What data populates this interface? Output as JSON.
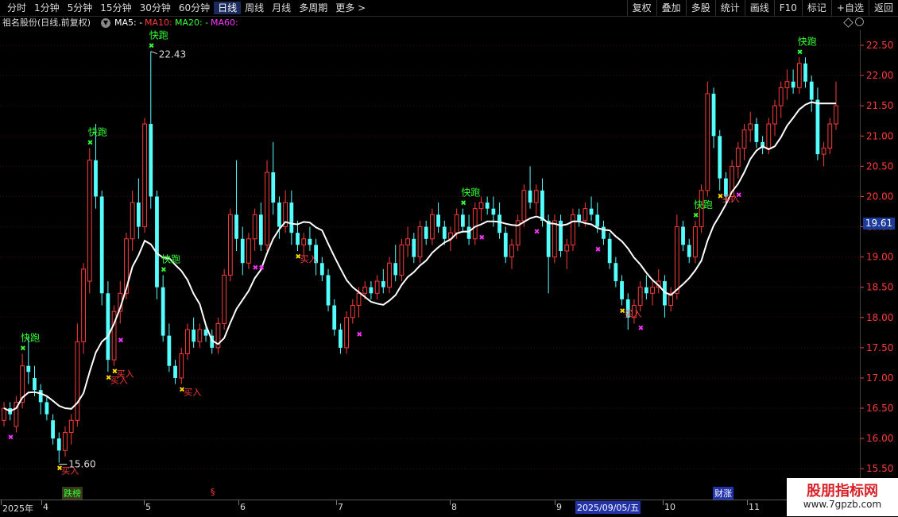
{
  "toolbar": {
    "tabs": [
      "分时",
      "1分钟",
      "5分钟",
      "15分钟",
      "30分钟",
      "60分钟",
      "日线",
      "周线",
      "月线",
      "多周期",
      "更多 >"
    ],
    "active_tab": "日线",
    "right_buttons": [
      "复权",
      "叠加",
      "多股",
      "统计",
      "画线",
      "F10",
      "标记",
      "+自选",
      "返回"
    ]
  },
  "info": {
    "stock": "祖名股份(日线,前复权)",
    "ma5": "MA5: -",
    "ma10": "MA10: -",
    "ma20": "MA20: -",
    "ma60": "MA60:"
  },
  "colors": {
    "up": "#ff3b3b",
    "down": "#54ffff",
    "ma": "#ffffff",
    "signal_sell": "#33ff33",
    "signal_buy": "#ff3b3b",
    "buy_marker": "#ffd700",
    "magenta": "#ff33ff",
    "axis": "#ff3b3b"
  },
  "price_axis": {
    "ticks": [
      "22.50",
      "22.00",
      "21.50",
      "21.00",
      "20.50",
      "20.00",
      "19.50",
      "19.00",
      "18.50",
      "18.00",
      "17.50",
      "17.00",
      "16.50",
      "16.00",
      "15.50"
    ],
    "current": "19.61"
  },
  "annotations": {
    "high": "22.43",
    "low": "15.60",
    "sell_label": "快跑",
    "buy_label": "买入"
  },
  "bottom_axis": {
    "labels": [
      "2025年",
      "4",
      "5",
      "6",
      "7",
      "8",
      "9",
      "10",
      "11"
    ],
    "highlight_date": "2025/09/05/五",
    "tags": [
      "跌榜",
      "§",
      "财涨"
    ]
  },
  "watermark": {
    "title": "股朋指标网",
    "url": "www.7gpzb.com"
  },
  "chart_data": {
    "type": "candlestick",
    "ylim": [
      15.45,
      22.75
    ],
    "candles": [
      [
        16.3,
        16.6,
        16.2,
        16.5
      ],
      [
        16.5,
        16.6,
        16.3,
        16.4
      ],
      [
        16.2,
        16.7,
        16.1,
        16.6
      ],
      [
        16.6,
        17.4,
        16.5,
        17.2
      ],
      [
        17.2,
        17.7,
        16.9,
        17.1
      ],
      [
        17.0,
        17.2,
        16.7,
        16.8
      ],
      [
        16.8,
        16.9,
        16.4,
        16.6
      ],
      [
        16.6,
        16.7,
        16.3,
        16.4
      ],
      [
        16.3,
        16.4,
        15.9,
        16.0
      ],
      [
        16.0,
        16.1,
        15.6,
        15.8
      ],
      [
        15.8,
        16.2,
        15.7,
        16.1
      ],
      [
        16.1,
        16.4,
        15.9,
        16.3
      ],
      [
        16.3,
        17.9,
        16.2,
        17.6
      ],
      [
        17.6,
        18.9,
        17.4,
        18.8
      ],
      [
        18.6,
        20.8,
        18.4,
        20.6
      ],
      [
        20.6,
        21.2,
        19.8,
        20.0
      ],
      [
        20.0,
        20.1,
        18.2,
        18.4
      ],
      [
        18.4,
        18.6,
        17.1,
        17.3
      ],
      [
        17.3,
        18.2,
        17.2,
        18.1
      ],
      [
        18.1,
        18.6,
        17.9,
        18.4
      ],
      [
        18.4,
        19.4,
        18.3,
        19.3
      ],
      [
        19.3,
        20.1,
        19.1,
        19.9
      ],
      [
        19.9,
        20.3,
        19.3,
        19.5
      ],
      [
        19.5,
        21.3,
        19.4,
        21.2
      ],
      [
        21.2,
        22.4,
        19.8,
        20.0
      ],
      [
        20.0,
        20.1,
        18.3,
        18.5
      ],
      [
        18.5,
        18.7,
        17.6,
        17.7
      ],
      [
        17.7,
        17.9,
        17.1,
        17.2
      ],
      [
        17.2,
        17.3,
        16.9,
        17.0
      ],
      [
        17.0,
        17.5,
        16.9,
        17.4
      ],
      [
        17.4,
        17.9,
        17.3,
        17.8
      ],
      [
        17.8,
        18.0,
        17.5,
        17.6
      ],
      [
        17.6,
        17.9,
        17.5,
        17.8
      ],
      [
        17.8,
        17.9,
        17.6,
        17.7
      ],
      [
        17.7,
        17.8,
        17.4,
        17.5
      ],
      [
        17.5,
        18.0,
        17.4,
        17.9
      ],
      [
        17.9,
        18.8,
        17.8,
        18.7
      ],
      [
        18.7,
        19.8,
        18.6,
        19.7
      ],
      [
        19.7,
        20.6,
        19.1,
        19.3
      ],
      [
        19.3,
        19.5,
        18.7,
        18.9
      ],
      [
        18.9,
        19.4,
        18.8,
        19.3
      ],
      [
        19.3,
        19.8,
        19.1,
        19.7
      ],
      [
        19.7,
        19.9,
        19.1,
        19.2
      ],
      [
        19.2,
        20.6,
        19.1,
        20.4
      ],
      [
        20.4,
        20.9,
        19.7,
        19.9
      ],
      [
        19.9,
        20.0,
        19.3,
        19.5
      ],
      [
        19.5,
        20.1,
        19.4,
        19.9
      ],
      [
        19.9,
        20.1,
        19.2,
        19.4
      ],
      [
        19.4,
        19.6,
        19.1,
        19.2
      ],
      [
        19.2,
        19.4,
        19.0,
        19.3
      ],
      [
        19.3,
        19.5,
        19.1,
        19.2
      ],
      [
        19.2,
        19.3,
        18.7,
        18.9
      ],
      [
        18.9,
        19.0,
        18.6,
        18.7
      ],
      [
        18.7,
        18.8,
        18.1,
        18.2
      ],
      [
        18.2,
        18.3,
        17.7,
        17.8
      ],
      [
        17.8,
        17.9,
        17.4,
        17.5
      ],
      [
        17.5,
        18.1,
        17.4,
        18.0
      ],
      [
        18.0,
        18.3,
        17.9,
        18.2
      ],
      [
        18.2,
        18.5,
        18.0,
        18.4
      ],
      [
        18.4,
        18.6,
        18.3,
        18.5
      ],
      [
        18.5,
        18.6,
        18.3,
        18.4
      ],
      [
        18.4,
        18.7,
        18.3,
        18.6
      ],
      [
        18.6,
        18.8,
        18.4,
        18.5
      ],
      [
        18.5,
        19.0,
        18.4,
        18.9
      ],
      [
        18.9,
        19.2,
        18.6,
        18.7
      ],
      [
        18.7,
        19.3,
        18.6,
        19.2
      ],
      [
        19.2,
        19.5,
        19.0,
        19.3
      ],
      [
        19.3,
        19.4,
        18.9,
        19.0
      ],
      [
        19.0,
        19.6,
        18.9,
        19.5
      ],
      [
        19.5,
        19.6,
        19.2,
        19.3
      ],
      [
        19.3,
        19.8,
        19.2,
        19.7
      ],
      [
        19.7,
        19.9,
        19.4,
        19.5
      ],
      [
        19.5,
        19.6,
        19.2,
        19.3
      ],
      [
        19.3,
        19.5,
        19.1,
        19.4
      ],
      [
        19.4,
        19.8,
        19.3,
        19.7
      ],
      [
        19.7,
        19.8,
        19.4,
        19.5
      ],
      [
        19.5,
        19.7,
        19.2,
        19.3
      ],
      [
        19.3,
        19.9,
        19.2,
        19.8
      ],
      [
        19.8,
        20.0,
        19.6,
        19.9
      ],
      [
        19.9,
        20.0,
        19.7,
        19.8
      ],
      [
        19.8,
        20.0,
        19.5,
        19.7
      ],
      [
        19.7,
        19.9,
        19.3,
        19.4
      ],
      [
        19.4,
        19.5,
        18.9,
        19.0
      ],
      [
        19.0,
        19.3,
        18.8,
        19.2
      ],
      [
        19.2,
        19.7,
        19.1,
        19.6
      ],
      [
        19.6,
        20.2,
        19.5,
        20.1
      ],
      [
        20.1,
        20.5,
        19.8,
        19.9
      ],
      [
        19.9,
        20.2,
        19.7,
        20.1
      ],
      [
        20.1,
        20.3,
        19.5,
        19.6
      ],
      [
        19.6,
        19.7,
        18.4,
        19.0
      ],
      [
        19.0,
        19.7,
        18.9,
        19.6
      ],
      [
        19.6,
        19.7,
        19.0,
        19.1
      ],
      [
        19.1,
        19.3,
        18.8,
        19.2
      ],
      [
        19.2,
        19.8,
        19.1,
        19.7
      ],
      [
        19.7,
        19.8,
        19.5,
        19.6
      ],
      [
        19.6,
        19.9,
        19.5,
        19.8
      ],
      [
        19.8,
        20.0,
        19.6,
        19.7
      ],
      [
        19.7,
        19.9,
        19.4,
        19.5
      ],
      [
        19.5,
        19.6,
        19.2,
        19.3
      ],
      [
        19.3,
        19.4,
        18.8,
        18.9
      ],
      [
        18.9,
        19.0,
        18.5,
        18.6
      ],
      [
        18.6,
        18.7,
        18.2,
        18.3
      ],
      [
        18.3,
        18.4,
        17.8,
        18.0
      ],
      [
        18.0,
        18.3,
        17.9,
        18.2
      ],
      [
        18.2,
        18.6,
        18.1,
        18.5
      ],
      [
        18.5,
        18.7,
        18.3,
        18.4
      ],
      [
        18.4,
        18.6,
        18.2,
        18.5
      ],
      [
        18.5,
        18.8,
        18.4,
        18.6
      ],
      [
        18.6,
        18.7,
        18.0,
        18.2
      ],
      [
        18.2,
        18.5,
        18.1,
        18.4
      ],
      [
        18.4,
        19.7,
        18.3,
        19.5
      ],
      [
        19.5,
        19.6,
        19.1,
        19.2
      ],
      [
        19.2,
        19.3,
        18.9,
        19.0
      ],
      [
        19.0,
        19.6,
        18.9,
        19.5
      ],
      [
        19.5,
        20.2,
        19.4,
        20.1
      ],
      [
        20.1,
        21.9,
        20.0,
        21.7
      ],
      [
        21.7,
        21.8,
        20.8,
        21.0
      ],
      [
        21.0,
        21.1,
        20.1,
        20.3
      ],
      [
        20.3,
        20.4,
        19.9,
        20.0
      ],
      [
        20.0,
        20.6,
        19.9,
        20.5
      ],
      [
        20.5,
        20.9,
        20.3,
        20.8
      ],
      [
        20.8,
        21.2,
        20.6,
        21.1
      ],
      [
        21.1,
        21.4,
        20.9,
        21.2
      ],
      [
        21.2,
        21.3,
        20.8,
        20.9
      ],
      [
        20.9,
        21.0,
        20.7,
        20.8
      ],
      [
        20.8,
        21.3,
        20.7,
        21.2
      ],
      [
        21.2,
        21.6,
        21.0,
        21.5
      ],
      [
        21.5,
        21.9,
        21.3,
        21.8
      ],
      [
        21.8,
        22.1,
        21.6,
        21.9
      ],
      [
        21.9,
        22.1,
        21.7,
        21.8
      ],
      [
        21.8,
        22.3,
        21.7,
        22.2
      ],
      [
        22.2,
        22.3,
        21.8,
        21.9
      ],
      [
        21.9,
        22.0,
        21.4,
        21.6
      ],
      [
        21.6,
        21.8,
        20.6,
        20.7
      ],
      [
        20.7,
        20.9,
        20.5,
        20.8
      ],
      [
        20.8,
        21.3,
        20.7,
        21.2
      ],
      [
        21.2,
        21.9,
        21.1,
        21.5
      ]
    ]
  }
}
